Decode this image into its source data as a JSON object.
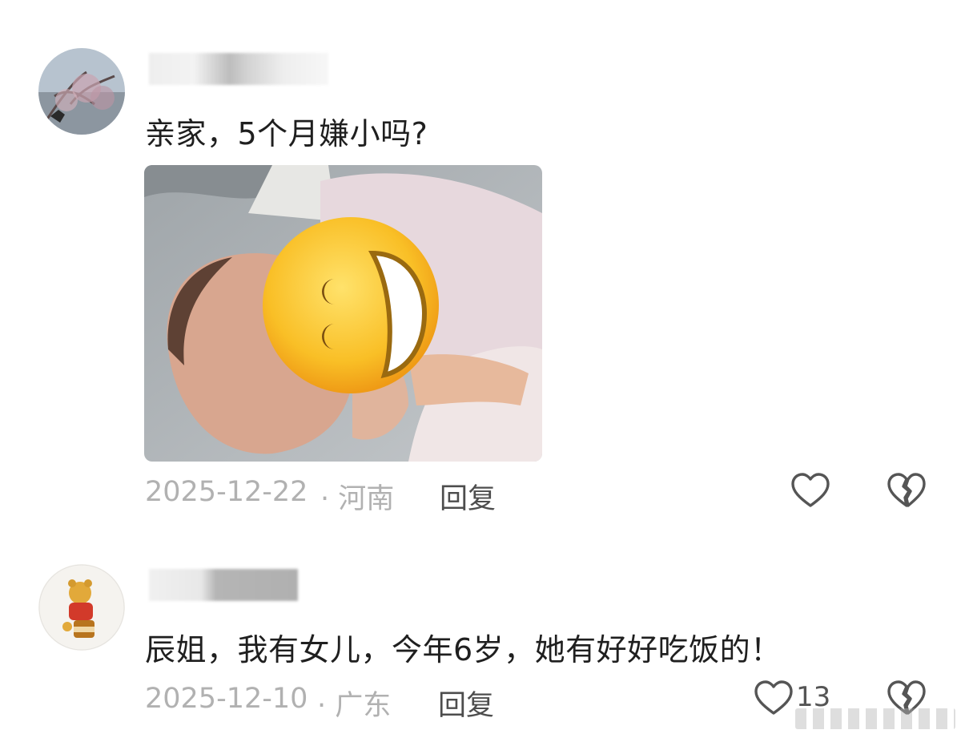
{
  "comments": [
    {
      "text": "亲家，5个月嫌小吗?",
      "date": "2025-12-22",
      "location": "· 河南",
      "reply_label": "回复",
      "like_icon": "heart-outline-icon",
      "dislike_icon": "broken-heart-icon",
      "image": {
        "emoji": "grinning-squinting-face-sticker"
      }
    },
    {
      "text": "辰姐，我有女儿，今年6岁，她有好好吃饭的！",
      "date": "2025-12-10",
      "location": "· 广东",
      "reply_label": "回复",
      "like_icon": "heart-outline-icon",
      "like_count": "13",
      "dislike_icon": "broken-heart-icon"
    }
  ],
  "colors": {
    "text": "#1f1f1f",
    "meta": "#b1b1b1",
    "reply": "#4d4d4d",
    "icon": "#555555",
    "emoji_yellow": "#f7b81f"
  }
}
